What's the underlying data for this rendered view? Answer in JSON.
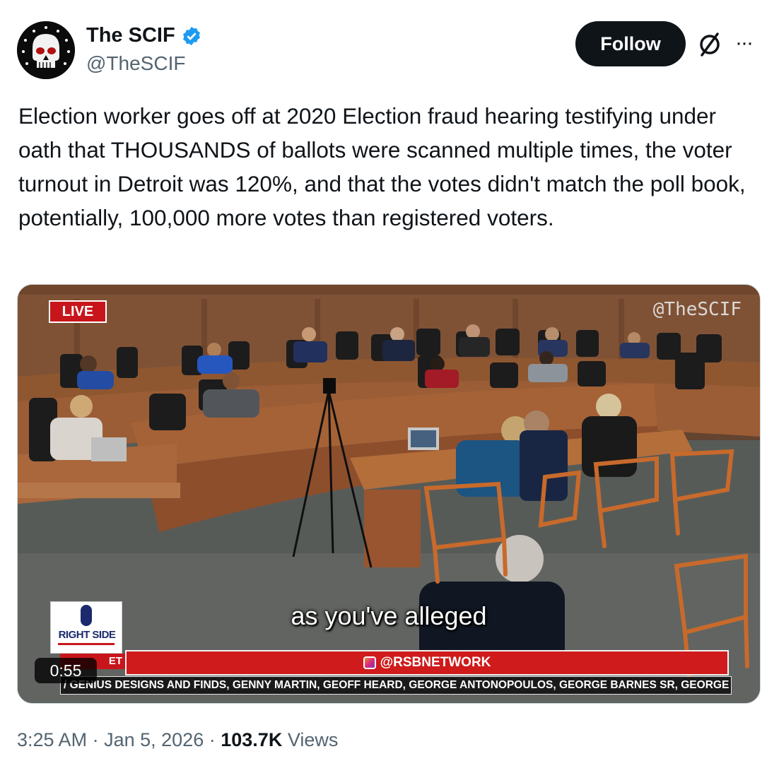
{
  "author": {
    "display_name": "The SCIF",
    "handle": "@TheSCIF",
    "verified": true,
    "accent_color": "#1d9bf0"
  },
  "actions": {
    "follow_label": "Follow",
    "grok_icon": "slashed-circle-icon",
    "more_icon": "more-horizontal-icon",
    "more_label": "···"
  },
  "tweet": {
    "text": "Election worker goes off at 2020 Election fraud hearing testifying under oath that THOUSANDS of ballots were scanned multiple times, the voter turnout in Detroit was 120%, and that the votes didn't match the poll book, potentially, 100,000 more votes than registered voters."
  },
  "video": {
    "live_badge": "LIVE",
    "watermark": "@TheSCIF",
    "caption": "as you've alleged",
    "logo_text": "RIGHT SIDE",
    "time_strip": "ET",
    "network_handle": "@RSBNETWORK",
    "ticker": "/ GENIUS DESIGNS AND FINDS, GENNY MARTIN, GEOFF HEARD, GEORGE ANTONOPOULOS, GEORGE BARNES SR, GEORGE",
    "duration": "0:55"
  },
  "meta": {
    "time": "3:25 AM",
    "separator": "·",
    "date": "Jan 5, 2026",
    "views_count": "103.7K",
    "views_label": "Views"
  }
}
